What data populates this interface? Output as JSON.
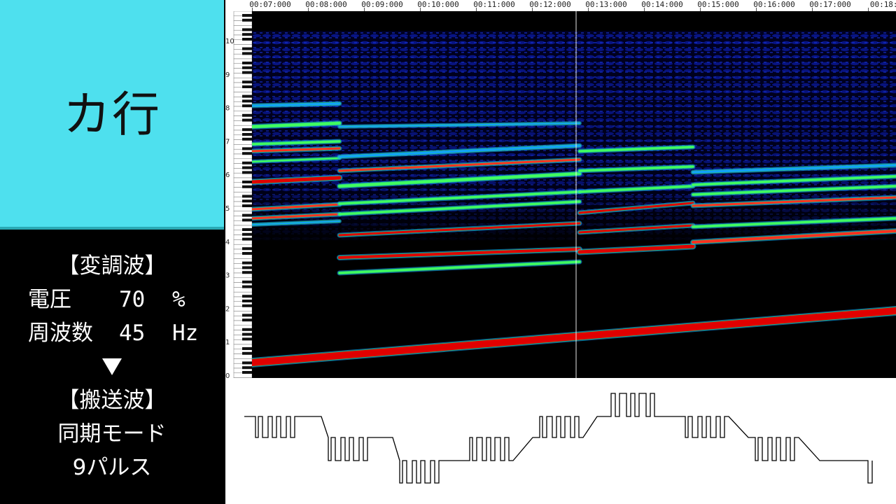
{
  "title": "カ行",
  "modulation": {
    "header": "【変調波】",
    "voltage": {
      "label": "電圧",
      "value": "70",
      "unit": "%"
    },
    "frequency": {
      "label": "周波数",
      "value": "45",
      "unit": "Hz"
    }
  },
  "arrow": "▼",
  "carrier": {
    "header": "【搬送波】",
    "mode": "同期モード",
    "pulses": "9パルス"
  },
  "timeline": {
    "ticks": [
      "00:07:000",
      "00:08:000",
      "00:09:000",
      "00:10:000",
      "00:11:000",
      "00:12:000",
      "00:13:000",
      "00:14:000",
      "00:15:000",
      "00:16:000",
      "00:17:000",
      "00:18:0"
    ]
  },
  "octave_labels": [
    "10",
    "9",
    "8",
    "7",
    "6",
    "5",
    "4",
    "3",
    "2",
    "1",
    "0"
  ],
  "colors": {
    "title_bg": "#4ee0ee",
    "fundamental": "#e00000",
    "harmonic_hot": "#ff3020",
    "harmonic_mid": "#40ff60",
    "harmonic_cool": "#10a0ff",
    "background_noise": "#0000a0"
  }
}
